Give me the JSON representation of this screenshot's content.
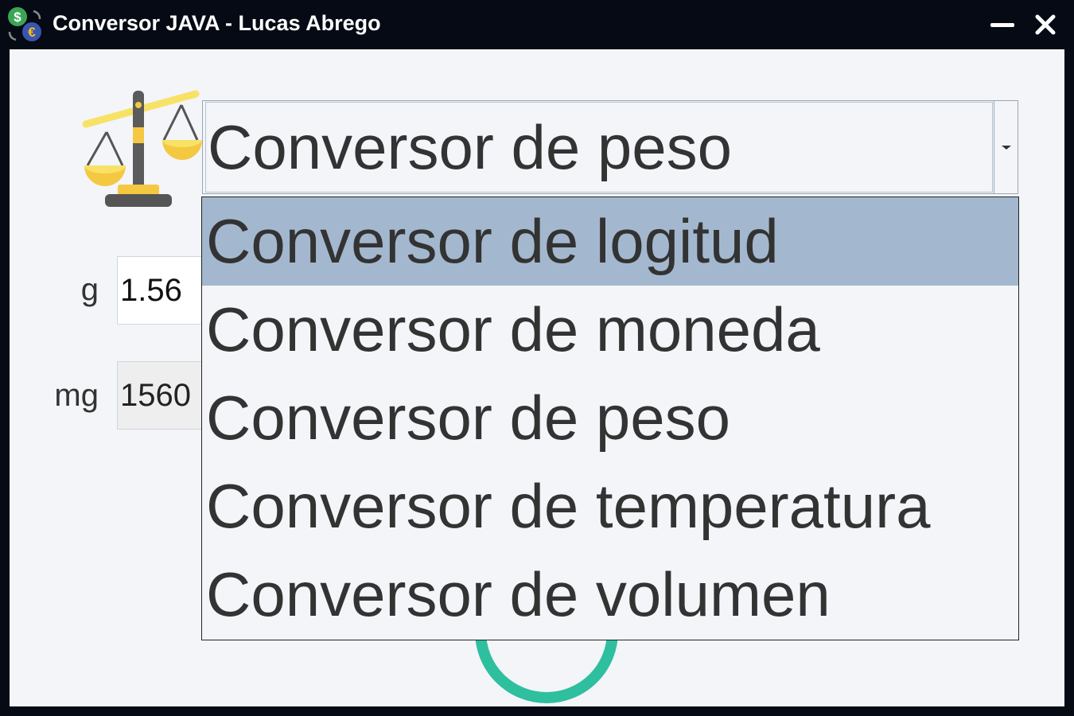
{
  "window": {
    "title": "Conversor JAVA - Lucas Abrego",
    "icon": "currency-exchange-icon"
  },
  "converter_select": {
    "selected": "Conversor de peso",
    "icon": "balance-scale-icon",
    "options": [
      "Conversor de logitud",
      "Conversor de moneda",
      "Conversor de peso",
      "Conversor de temperatura",
      "Conversor de volumen"
    ],
    "highlighted": "Conversor de logitud"
  },
  "input_row": {
    "unit": "g",
    "value": "1.56"
  },
  "output_row": {
    "unit": "mg",
    "value": "1560"
  },
  "colors": {
    "highlight": "#a3b8ce",
    "accent": "#2ebf9f",
    "background": "#f3f5f9",
    "titlebar": "#050a14"
  }
}
